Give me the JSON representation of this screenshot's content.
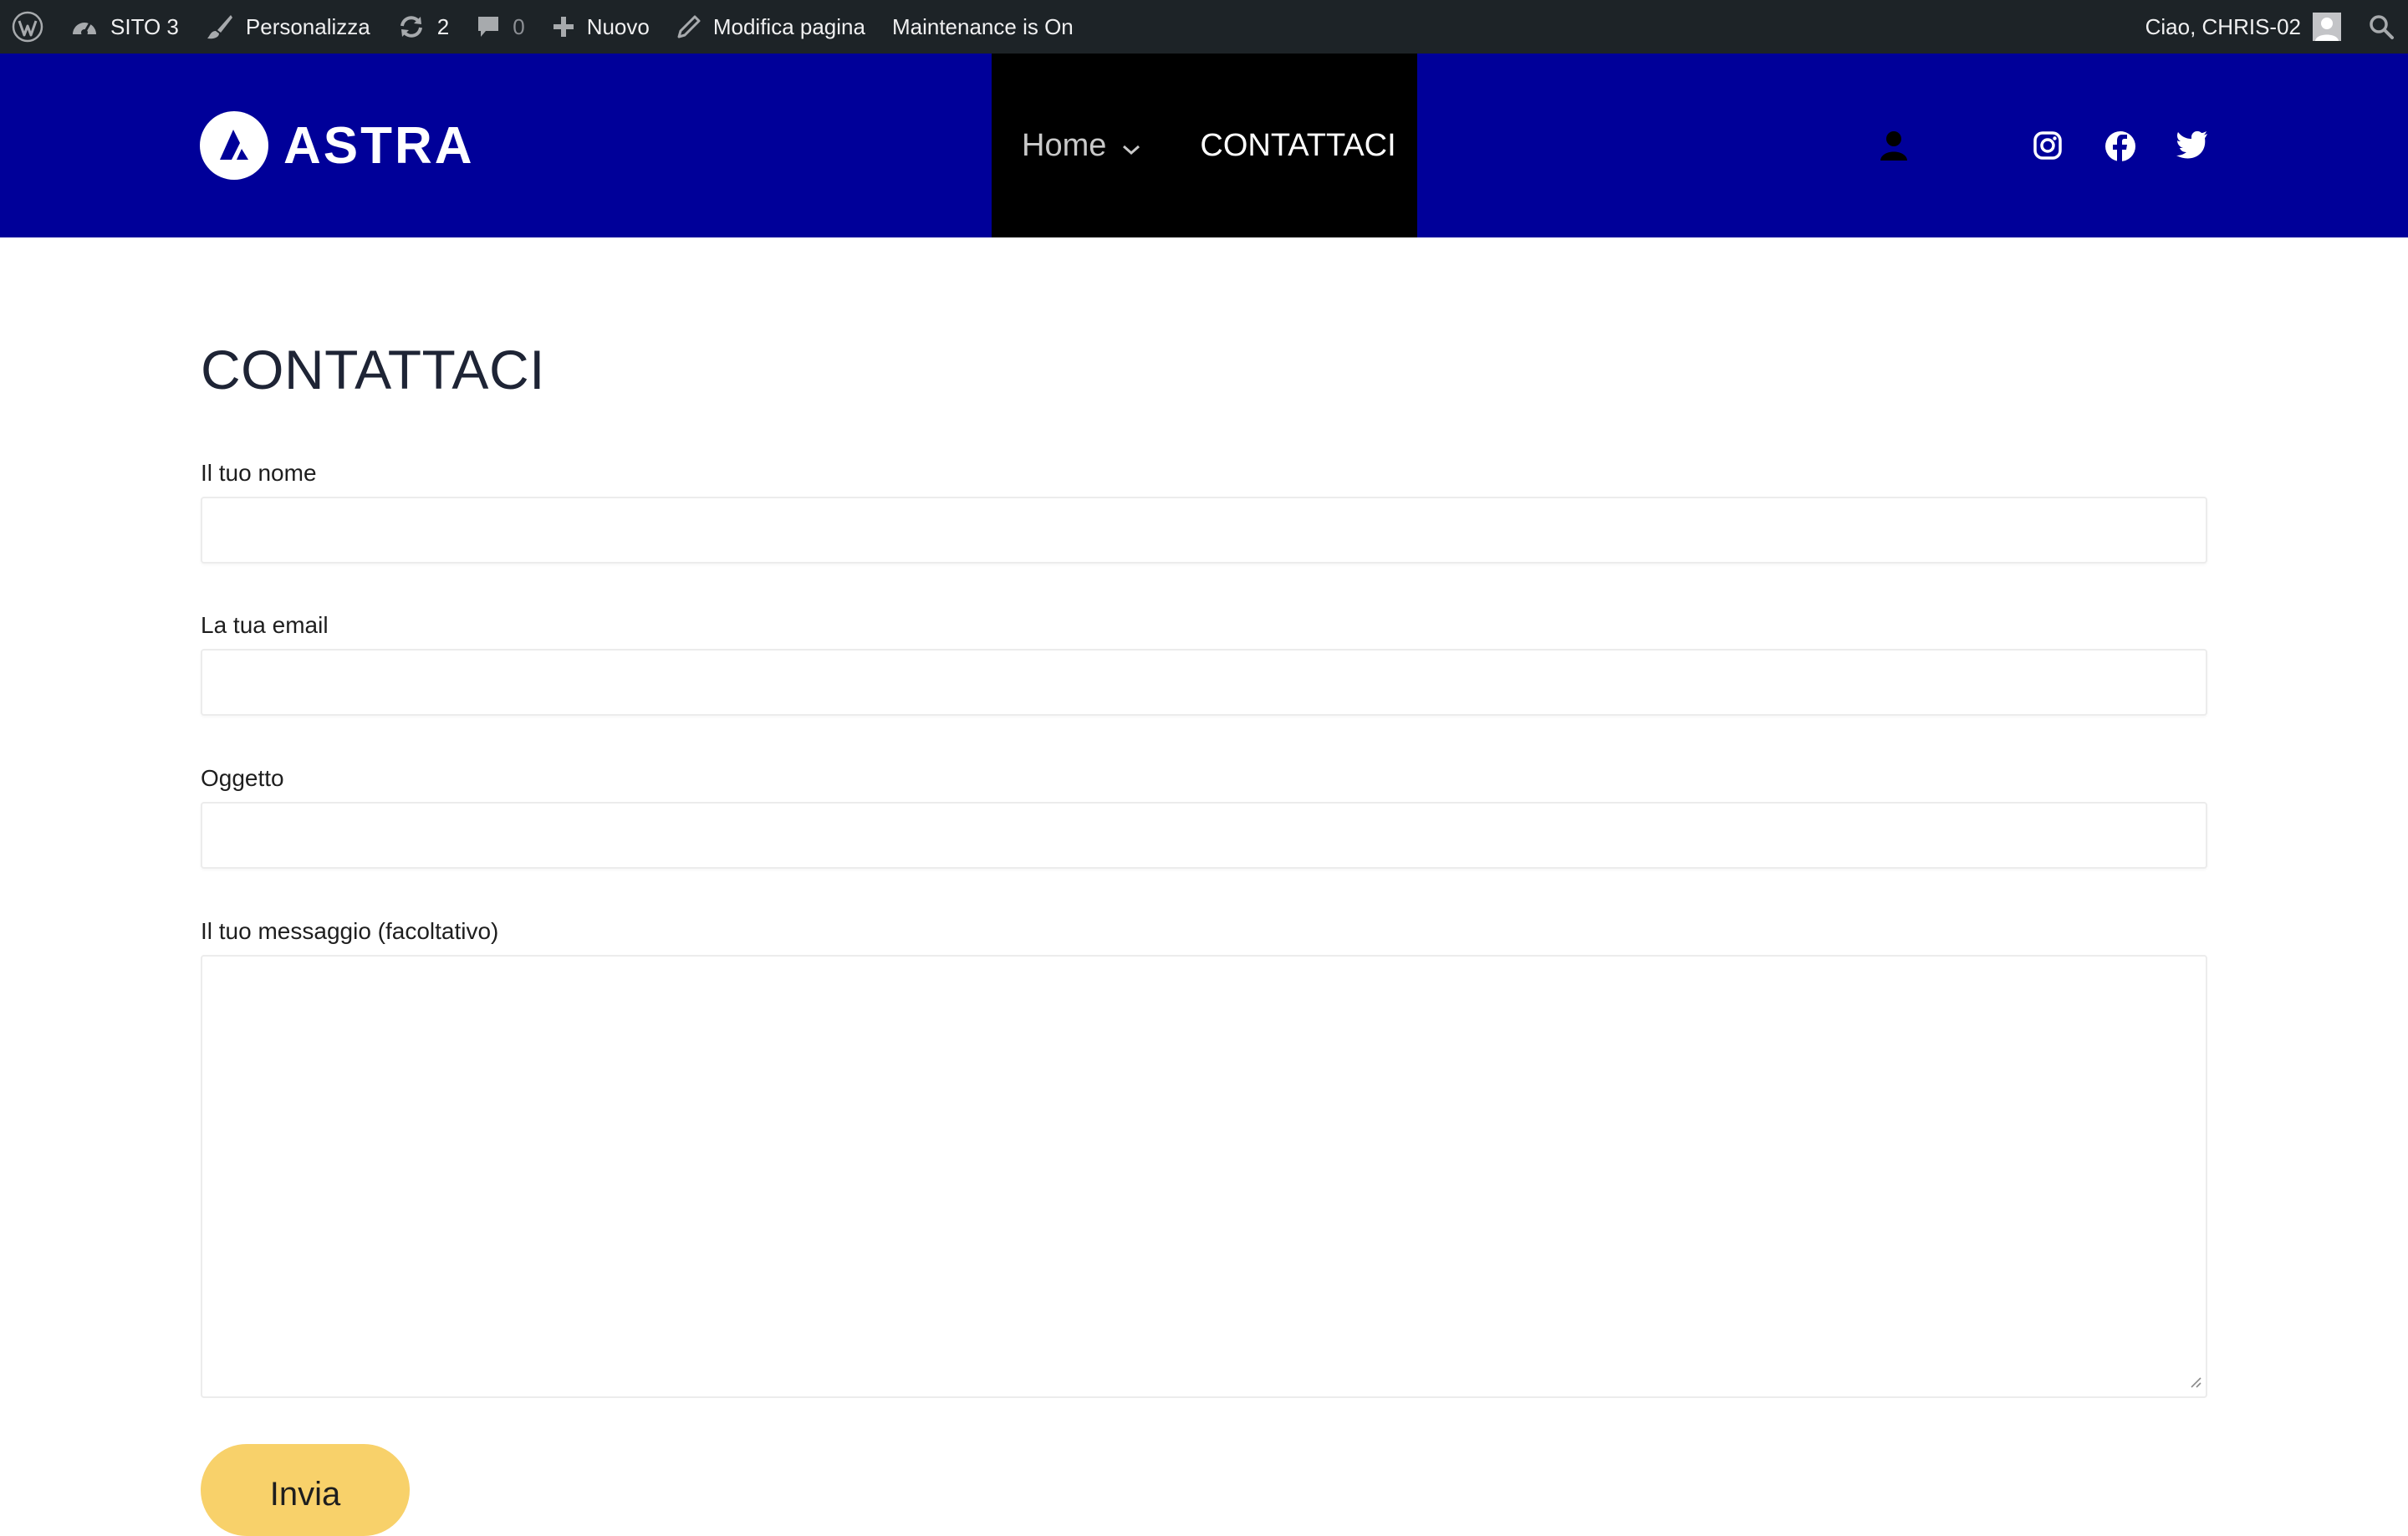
{
  "admin_bar": {
    "site_name": "SITO 3",
    "customize": "Personalizza",
    "updates_count": "2",
    "comments_count": "0",
    "new": "Nuovo",
    "edit_page": "Modifica pagina",
    "maintenance": "Maintenance is On",
    "greeting": "Ciao, CHRIS-02",
    "icons": [
      "wordpress-icon",
      "dashboard-icon",
      "brush-icon",
      "updates-icon",
      "comment-icon",
      "plus-icon",
      "pencil-icon",
      "avatar",
      "search-icon"
    ]
  },
  "header": {
    "logo_text": "ASTRA",
    "nav": [
      {
        "label": "Home",
        "has_submenu": true
      },
      {
        "label": "CONTATTACI",
        "has_submenu": false
      }
    ],
    "social_icons": [
      "user-account-icon",
      "instagram-icon",
      "facebook-icon",
      "twitter-icon"
    ]
  },
  "page": {
    "title": "CONTATTACI"
  },
  "form": {
    "name_label": "Il tuo nome",
    "email_label": "La tua email",
    "subject_label": "Oggetto",
    "message_label": "Il tuo messaggio (facoltativo)",
    "name_value": "",
    "email_value": "",
    "subject_value": "",
    "message_value": "",
    "submit_label": "Invia"
  },
  "colors": {
    "admin_bar_bg": "#1d2327",
    "header_bg": "#000099",
    "nav_bg": "#000000",
    "button_bg": "#f8d16a",
    "title_color": "#1e2435"
  }
}
